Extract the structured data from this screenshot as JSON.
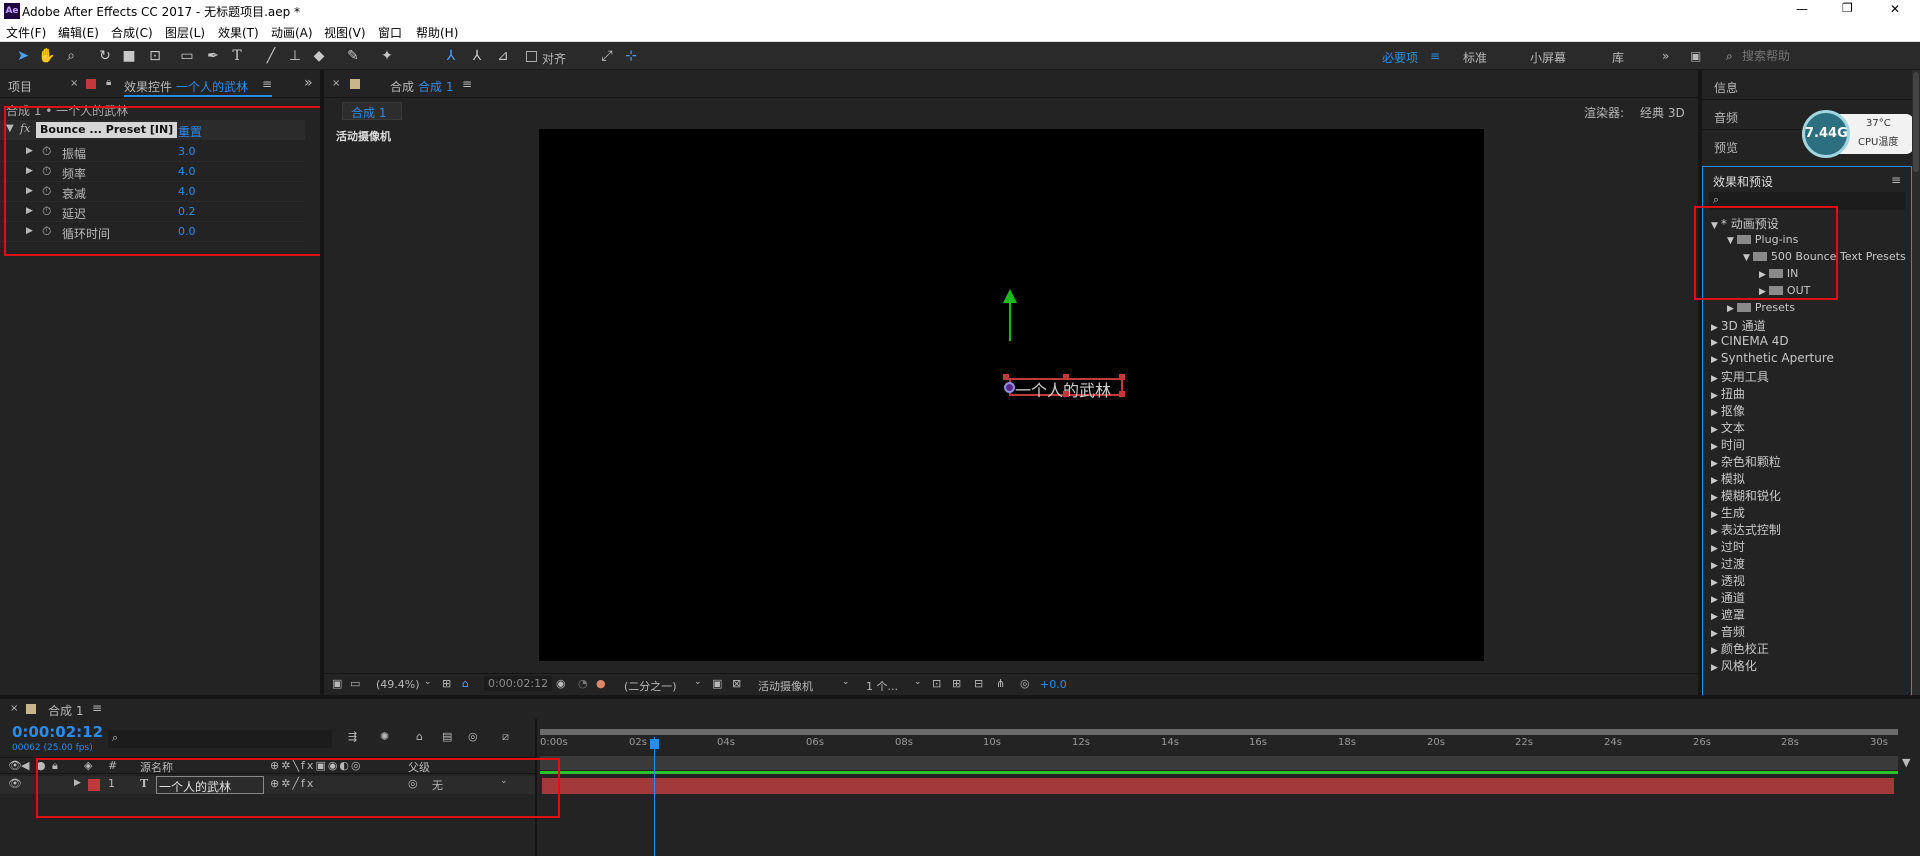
{
  "window": {
    "app_icon": "Ae",
    "title": "Adobe After Effects CC 2017 - 无标题项目.aep *",
    "controls": [
      "—",
      "❐",
      "✕"
    ]
  },
  "menu": [
    "文件(F)",
    "编辑(E)",
    "合成(C)",
    "图层(L)",
    "效果(T)",
    "动画(A)",
    "视图(V)",
    "窗口",
    "帮助(H)"
  ],
  "toolbar": {
    "align_label": "对齐",
    "workspaces": [
      "必要项",
      "标准",
      "小屏幕",
      "库"
    ],
    "active_workspace": "必要项",
    "search_placeholder": "搜索帮助"
  },
  "left_panel": {
    "tab_project": "项目",
    "tab_effects_prefix": "效果控件",
    "tab_effects_layer": "一个人的武林",
    "breadcrumb": "合成 1 • 一个人的武林",
    "effect_name": "Bounce ... Preset [IN]",
    "reset_label": "重置",
    "params": [
      {
        "label": "振幅",
        "value": "3.0"
      },
      {
        "label": "频率",
        "value": "4.0"
      },
      {
        "label": "衰减",
        "value": "4.0"
      },
      {
        "label": "延迟",
        "value": "0.2"
      },
      {
        "label": "循环时间",
        "value": "0.0"
      }
    ]
  },
  "composition": {
    "tab_label": "合成",
    "tab_name": "合成 1",
    "subtab": "合成 1",
    "renderer_label": "渲染器:",
    "renderer_value": "经典 3D",
    "camera_label": "活动摄像机",
    "text_layer": "一个人的武林",
    "footer": {
      "zoom": "(49.4%)",
      "timecode": "0:00:02:12",
      "resolution": "(二分之一)",
      "view": "活动摄像机",
      "views_count": "1 个...",
      "exposure": "+0.0"
    }
  },
  "right_panel": {
    "info": "信息",
    "audio": "音频",
    "preview": "预览",
    "cpu_widget": {
      "mem": "7.44G",
      "temp": "37°C",
      "label": "CPU温度"
    },
    "effects_title": "效果和预设",
    "search_placeholder": "",
    "tree": [
      {
        "label": "* 动画预设",
        "level": 0,
        "arrow": "▼",
        "folder": false
      },
      {
        "label": "Plug-ins",
        "level": 1,
        "arrow": "▼",
        "folder": true
      },
      {
        "label": "500 Bounce Text Presets",
        "level": 2,
        "arrow": "▼",
        "folder": true
      },
      {
        "label": "IN",
        "level": 3,
        "arrow": "▶",
        "folder": true
      },
      {
        "label": "OUT",
        "level": 3,
        "arrow": "▶",
        "folder": true
      },
      {
        "label": "Presets",
        "level": 1,
        "arrow": "▶",
        "folder": true
      },
      {
        "label": "3D 通道",
        "level": 0,
        "arrow": "▶",
        "folder": false
      },
      {
        "label": "CINEMA 4D",
        "level": 0,
        "arrow": "▶",
        "folder": false
      },
      {
        "label": "Synthetic Aperture",
        "level": 0,
        "arrow": "▶",
        "folder": false
      },
      {
        "label": "实用工具",
        "level": 0,
        "arrow": "▶",
        "folder": false
      },
      {
        "label": "扭曲",
        "level": 0,
        "arrow": "▶",
        "folder": false
      },
      {
        "label": "抠像",
        "level": 0,
        "arrow": "▶",
        "folder": false
      },
      {
        "label": "文本",
        "level": 0,
        "arrow": "▶",
        "folder": false
      },
      {
        "label": "时间",
        "level": 0,
        "arrow": "▶",
        "folder": false
      },
      {
        "label": "杂色和颗粒",
        "level": 0,
        "arrow": "▶",
        "folder": false
      },
      {
        "label": "模拟",
        "level": 0,
        "arrow": "▶",
        "folder": false
      },
      {
        "label": "模糊和锐化",
        "level": 0,
        "arrow": "▶",
        "folder": false
      },
      {
        "label": "生成",
        "level": 0,
        "arrow": "▶",
        "folder": false
      },
      {
        "label": "表达式控制",
        "level": 0,
        "arrow": "▶",
        "folder": false
      },
      {
        "label": "过时",
        "level": 0,
        "arrow": "▶",
        "folder": false
      },
      {
        "label": "过渡",
        "level": 0,
        "arrow": "▶",
        "folder": false
      },
      {
        "label": "透视",
        "level": 0,
        "arrow": "▶",
        "folder": false
      },
      {
        "label": "通道",
        "level": 0,
        "arrow": "▶",
        "folder": false
      },
      {
        "label": "遮罩",
        "level": 0,
        "arrow": "▶",
        "folder": false
      },
      {
        "label": "音频",
        "level": 0,
        "arrow": "▶",
        "folder": false
      },
      {
        "label": "颜色校正",
        "level": 0,
        "arrow": "▶",
        "folder": false
      },
      {
        "label": "风格化",
        "level": 0,
        "arrow": "▶",
        "folder": false
      }
    ]
  },
  "timeline": {
    "tab": "合成 1",
    "timecode": "0:00:02:12",
    "frames": "00062 (25.00 fps)",
    "col_num": "#",
    "col_source": "源名称",
    "col_parent": "父级",
    "layer": {
      "index": "1",
      "type": "T",
      "name": "一个人的武林",
      "parent": "无"
    },
    "ruler": [
      "0:00s",
      "02s",
      "04s",
      "06s",
      "08s",
      "10s",
      "12s",
      "14s",
      "16s",
      "18s",
      "20s",
      "22s",
      "24s",
      "26s",
      "28s",
      "30s"
    ]
  },
  "colors": {
    "accent": "#2d8ceb",
    "highlight": "#e01010",
    "layer_bar": "#a33a3a",
    "label_red": "#c0393b"
  }
}
